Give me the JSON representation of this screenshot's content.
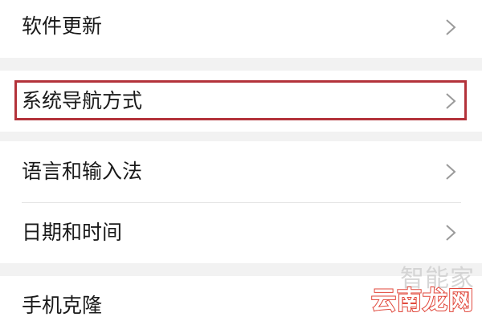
{
  "settings": {
    "items": [
      {
        "label": "软件更新"
      },
      {
        "label": "系统导航方式",
        "highlighted": true
      },
      {
        "label": "语言和输入法"
      },
      {
        "label": "日期和时间"
      },
      {
        "label": "手机克隆"
      }
    ]
  },
  "watermark": {
    "top_text": "智能家",
    "bottom_text": "云南龙网"
  },
  "colors": {
    "highlight_border": "#b3323a",
    "watermark_outline": "#e0463a",
    "group_gap": "#f2f2f2"
  },
  "icons": {
    "row_chevron": "chevron-right-icon"
  }
}
